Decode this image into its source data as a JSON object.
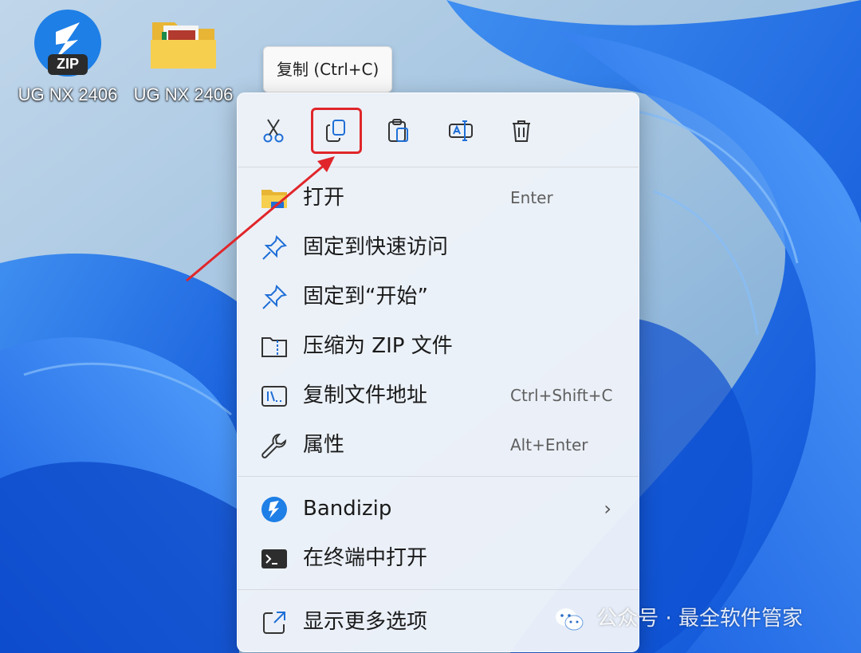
{
  "desktop": {
    "icons": [
      {
        "label": "UG NX 2406",
        "icon": "bandizip-zip-icon",
        "badge": "ZIP"
      },
      {
        "label": "UG NX 2406",
        "icon": "folder-icon"
      }
    ]
  },
  "tooltip": {
    "text": "复制 (Ctrl+C)"
  },
  "context_menu": {
    "toolbar": [
      {
        "name": "cut",
        "icon": "scissors-icon"
      },
      {
        "name": "copy",
        "icon": "copy-icon",
        "highlighted": true
      },
      {
        "name": "paste",
        "icon": "paste-icon"
      },
      {
        "name": "rename",
        "icon": "rename-icon"
      },
      {
        "name": "delete",
        "icon": "trash-icon"
      }
    ],
    "items": [
      {
        "label": "打开",
        "shortcut": "Enter",
        "icon": "folder-icon"
      },
      {
        "label": "固定到快速访问",
        "shortcut": "",
        "icon": "pin-icon"
      },
      {
        "label": "固定到“开始”",
        "shortcut": "",
        "icon": "pin-icon"
      },
      {
        "label": "压缩为 ZIP 文件",
        "shortcut": "",
        "icon": "zip-folder-icon"
      },
      {
        "label": "复制文件地址",
        "shortcut": "Ctrl+Shift+C",
        "icon": "path-icon"
      },
      {
        "label": "属性",
        "shortcut": "Alt+Enter",
        "icon": "wrench-icon"
      },
      {
        "label": "Bandizip",
        "shortcut": "",
        "icon": "bandizip-icon",
        "submenu": true
      },
      {
        "label": "在终端中打开",
        "shortcut": "",
        "icon": "terminal-icon"
      },
      {
        "label": "显示更多选项",
        "shortcut": "",
        "icon": "external-icon"
      }
    ]
  },
  "watermark": {
    "text": "公众号 · 最全软件管家"
  },
  "colors": {
    "highlight_border": "#e0262a",
    "arrow": "#e0262a",
    "accent": "#1f6fd6"
  }
}
